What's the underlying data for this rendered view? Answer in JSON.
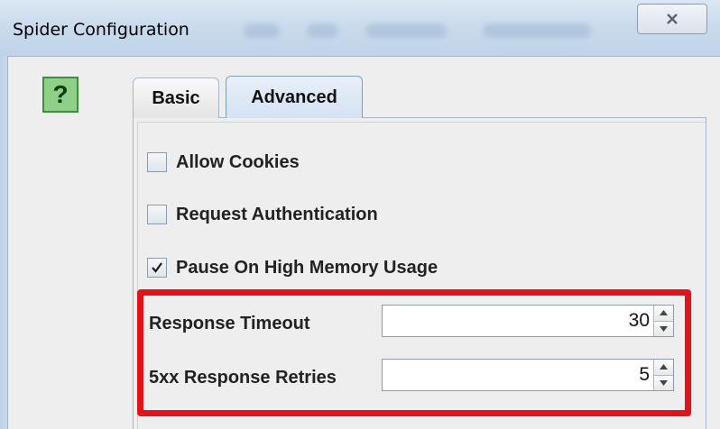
{
  "window": {
    "title": "Spider Configuration",
    "close_symbol": "close-icon"
  },
  "help": {
    "label": "?"
  },
  "tabs": [
    {
      "label": "Basic",
      "selected": false
    },
    {
      "label": "Advanced",
      "selected": true
    }
  ],
  "options": {
    "allow_cookies": {
      "label": "Allow Cookies",
      "checked": false
    },
    "request_auth": {
      "label": "Request Authentication",
      "checked": false
    },
    "pause_memory": {
      "label": "Pause On High Memory Usage",
      "checked": true
    }
  },
  "fields": {
    "response_timeout": {
      "label": "Response Timeout",
      "value": "30"
    },
    "retries": {
      "label": "5xx Response Retries",
      "value": "5"
    }
  },
  "colors": {
    "highlight": "#e0141a",
    "help_bg": "#8fcf8a"
  }
}
